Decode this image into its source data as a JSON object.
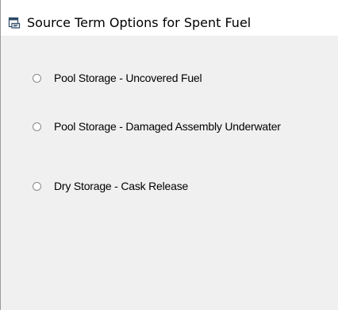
{
  "window": {
    "title": "Source Term Options for Spent Fuel",
    "icon": "form-window-icon"
  },
  "options": [
    {
      "label": "Pool Storage - Uncovered Fuel",
      "selected": false
    },
    {
      "label": "Pool Storage - Damaged Assembly Underwater",
      "selected": false
    },
    {
      "label": "Dry Storage - Cask Release",
      "selected": false
    }
  ],
  "colors": {
    "titlebar_bg": "#ffffff",
    "client_bg": "#f0f0f0",
    "radio_border": "#8a8a8a"
  }
}
